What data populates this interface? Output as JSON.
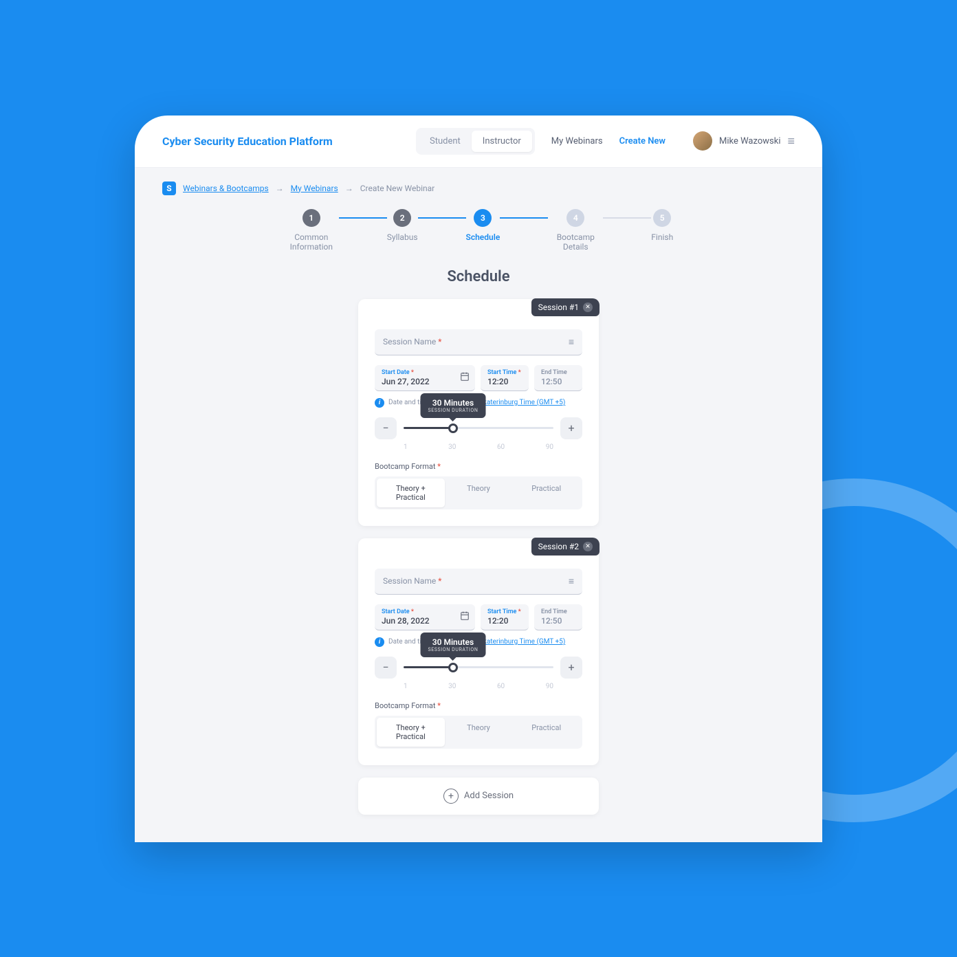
{
  "header": {
    "logo": "Cyber Security Education Platform",
    "main_tabs": {
      "student": "Student",
      "instructor": "Instructor"
    },
    "nav": {
      "my_webinars": "My Webinars",
      "create_new": "Create New"
    },
    "user": "Mike Wazowski"
  },
  "breadcrumb": {
    "badge": "S",
    "items": [
      "Webinars & Bootcamps",
      "My Webinars",
      "Create New Webinar"
    ]
  },
  "stepper": [
    {
      "num": "1",
      "label": "Common Information",
      "state": "done"
    },
    {
      "num": "2",
      "label": "Syllabus",
      "state": "done"
    },
    {
      "num": "3",
      "label": "Schedule",
      "state": "active"
    },
    {
      "num": "4",
      "label": "Bootcamp Details",
      "state": "pending"
    },
    {
      "num": "5",
      "label": "Finish",
      "state": "pending"
    }
  ],
  "page_title": "Schedule",
  "labels": {
    "session_name": "Session Name",
    "start_date": "Start Date",
    "start_time": "Start Time",
    "end_time": "End Time",
    "tz_prefix": "Date and time are shown in ",
    "tz_link": "Yekaterinburg Time (GMT +5)",
    "duration_sub": "SESSION DURATION",
    "format_label": "Bootcamp Format",
    "add_session": "Add Session",
    "ticks": [
      "1",
      "30",
      "60",
      "90"
    ]
  },
  "format_options": [
    "Theory + Practical",
    "Theory",
    "Practical"
  ],
  "sessions": [
    {
      "badge": "Session #1",
      "start_date": "Jun 27, 2022",
      "start_time": "12:20",
      "end_time": "12:50",
      "duration": "30 Minutes"
    },
    {
      "badge": "Session #2",
      "start_date": "Jun 28, 2022",
      "start_time": "12:20",
      "end_time": "12:50",
      "duration": "30 Minutes"
    }
  ]
}
